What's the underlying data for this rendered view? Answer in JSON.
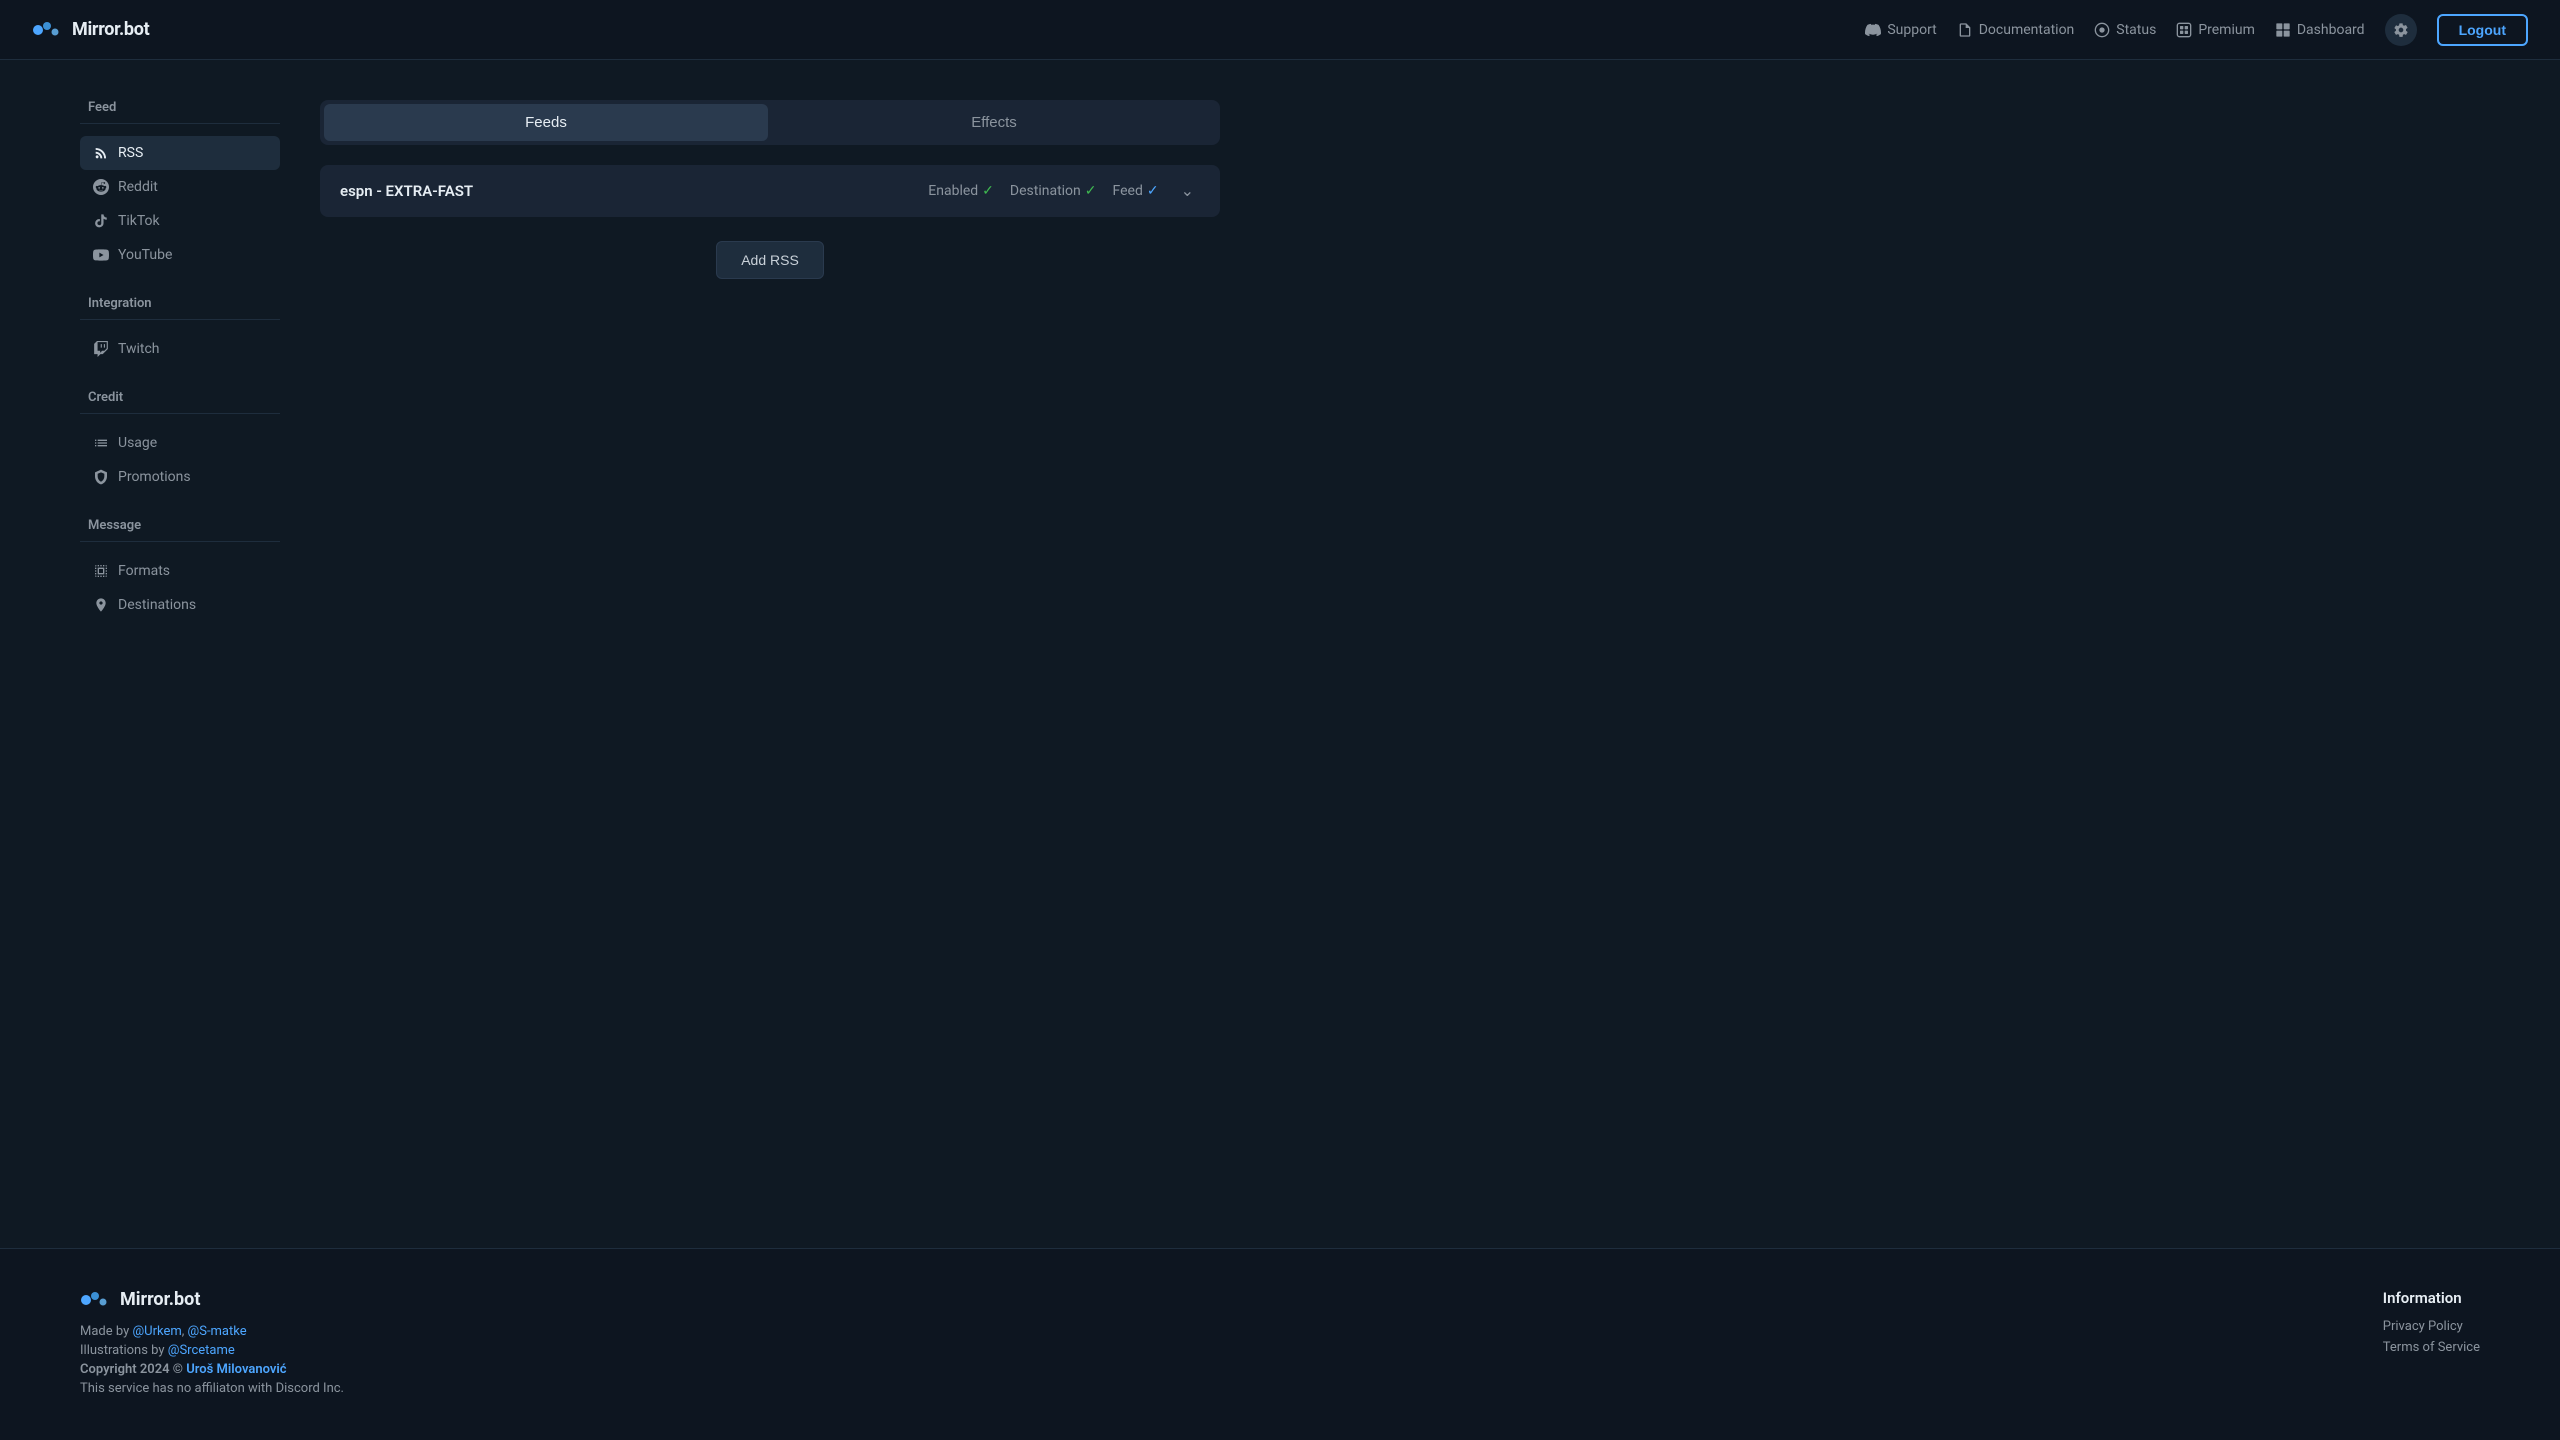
{
  "app": {
    "name": "Mirror.bot"
  },
  "header": {
    "logo_text": "Mirror.bot",
    "nav_items": [
      {
        "id": "support",
        "label": "Support",
        "icon": "discord-icon"
      },
      {
        "id": "documentation",
        "label": "Documentation",
        "icon": "file-icon"
      },
      {
        "id": "status",
        "label": "Status",
        "icon": "status-icon"
      },
      {
        "id": "premium",
        "label": "Premium",
        "icon": "premium-icon"
      },
      {
        "id": "dashboard",
        "label": "Dashboard",
        "icon": "dashboard-icon"
      }
    ],
    "logout_label": "Logout"
  },
  "sidebar": {
    "sections": [
      {
        "id": "feed",
        "title": "Feed",
        "items": [
          {
            "id": "rss",
            "label": "RSS",
            "icon": "rss-icon",
            "active": true
          },
          {
            "id": "reddit",
            "label": "Reddit",
            "icon": "reddit-icon"
          },
          {
            "id": "tiktok",
            "label": "TikTok",
            "icon": "tiktok-icon"
          },
          {
            "id": "youtube",
            "label": "YouTube",
            "icon": "youtube-icon"
          }
        ]
      },
      {
        "id": "integration",
        "title": "Integration",
        "items": [
          {
            "id": "twitch",
            "label": "Twitch",
            "icon": "twitch-icon"
          }
        ]
      },
      {
        "id": "credit",
        "title": "Credit",
        "items": [
          {
            "id": "usage",
            "label": "Usage",
            "icon": "usage-icon"
          },
          {
            "id": "promotions",
            "label": "Promotions",
            "icon": "promotions-icon"
          }
        ]
      },
      {
        "id": "message",
        "title": "Message",
        "items": [
          {
            "id": "formats",
            "label": "Formats",
            "icon": "formats-icon"
          },
          {
            "id": "destinations",
            "label": "Destinations",
            "icon": "destinations-icon"
          }
        ]
      }
    ]
  },
  "content": {
    "tabs": [
      {
        "id": "feeds",
        "label": "Feeds",
        "active": true
      },
      {
        "id": "effects",
        "label": "Effects",
        "active": false
      }
    ],
    "feed_rows": [
      {
        "id": "espn-extra-fast",
        "name": "espn - EXTRA-FAST",
        "enabled": true,
        "enabled_label": "Enabled",
        "destination": true,
        "destination_label": "Destination",
        "feed": true,
        "feed_label": "Feed"
      }
    ],
    "add_rss_label": "Add RSS"
  },
  "footer": {
    "logo_text": "Mirror.bot",
    "made_by_text": "Made by ",
    "made_by_authors": "@Urkem, @S-matke",
    "made_by_author1": "@Urkem",
    "made_by_author2": "@S-matke",
    "illustrations_text": "Illustrations by ",
    "illustrations_author": "@Srcetame",
    "copyright_text": "Copyright 2024 © ",
    "copyright_author": "Uroš Milovanović",
    "disclaimer": "This service has no affiliaton with Discord Inc.",
    "information_title": "Information",
    "links": [
      {
        "id": "privacy-policy",
        "label": "Privacy Policy"
      },
      {
        "id": "terms-of-service",
        "label": "Terms of Service"
      }
    ]
  }
}
